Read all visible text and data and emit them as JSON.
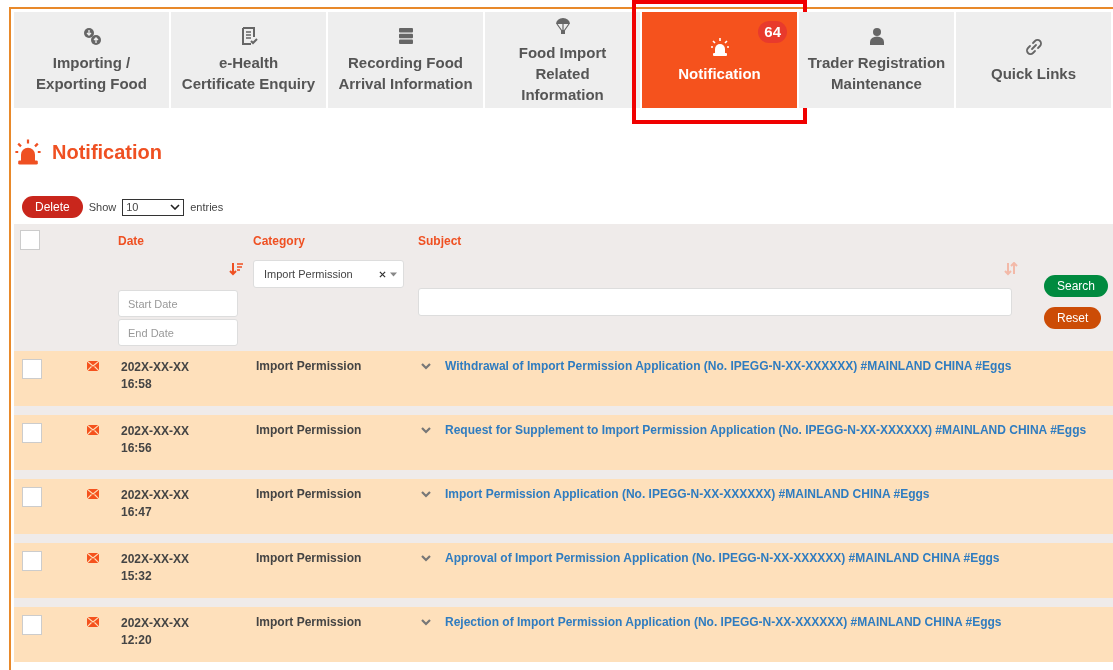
{
  "tabs": [
    {
      "label_lines": [
        "Importing /",
        "Exporting Food"
      ],
      "selected": false,
      "highlighted": false
    },
    {
      "label_lines": [
        "e-Health",
        "Certificate Enquiry"
      ],
      "selected": false,
      "highlighted": false
    },
    {
      "label_lines": [
        "Recording Food",
        "Arrival Information"
      ],
      "selected": false,
      "highlighted": false
    },
    {
      "label_lines": [
        "Food Import",
        "Related",
        "Information"
      ],
      "selected": false,
      "highlighted": false
    },
    {
      "label_lines": [
        "Notification"
      ],
      "badge": "64",
      "selected": true,
      "highlighted": true
    },
    {
      "label_lines": [
        "Trader Registration",
        "Maintenance"
      ],
      "selected": false,
      "highlighted": false
    },
    {
      "label_lines": [
        "Quick Links"
      ],
      "selected": false,
      "highlighted": false
    }
  ],
  "page_title": "Notification",
  "toolbar": {
    "delete_button": "Delete",
    "show_label": "Show",
    "page_size": "10",
    "entries_label": "entries"
  },
  "table": {
    "select_all_checked": false,
    "columns": [
      {
        "label": "Date",
        "sortable": true,
        "sorted": true
      },
      {
        "label": "Category"
      },
      {
        "label": "Subject",
        "sortable": true,
        "sorted": false
      }
    ],
    "filters": {
      "start_date_placeholder": "Start Date",
      "end_date_placeholder": "End Date",
      "category": "Import Permission",
      "search_button": "Search",
      "reset_button": "Reset"
    },
    "rows": [
      {
        "checked": false,
        "unread": true,
        "date": "202X-XX-XX",
        "time": "16:58",
        "category": "Import Permission",
        "subject": "Withdrawal of Import Permission Application (No. IPEGG-N-XX-XXXXXX) #MAINLAND CHINA #Eggs"
      },
      {
        "checked": false,
        "unread": true,
        "date": "202X-XX-XX",
        "time": "16:56",
        "category": "Import Permission",
        "subject": "Request for Supplement to Import Permission Application (No. IPEGG-N-XX-XXXXXX) #MAINLAND CHINA #Eggs"
      },
      {
        "checked": false,
        "unread": true,
        "date": "202X-XX-XX",
        "time": "16:47",
        "category": "Import Permission",
        "subject": "Import Permission Application (No. IPEGG-N-XX-XXXXXX) #MAINLAND CHINA #Eggs"
      },
      {
        "checked": false,
        "unread": true,
        "date": "202X-XX-XX",
        "time": "15:32",
        "category": "Import Permission",
        "subject": "Approval of Import Permission Application (No. IPEGG-N-XX-XXXXXX) #MAINLAND CHINA #Eggs"
      },
      {
        "checked": false,
        "unread": true,
        "date": "202X-XX-XX",
        "time": "12:20",
        "category": "Import Permission",
        "subject": "Rejection of Import Permission Application (No. IPEGG-N-XX-XXXXXX) #MAINLAND CHINA #Eggs"
      }
    ]
  }
}
